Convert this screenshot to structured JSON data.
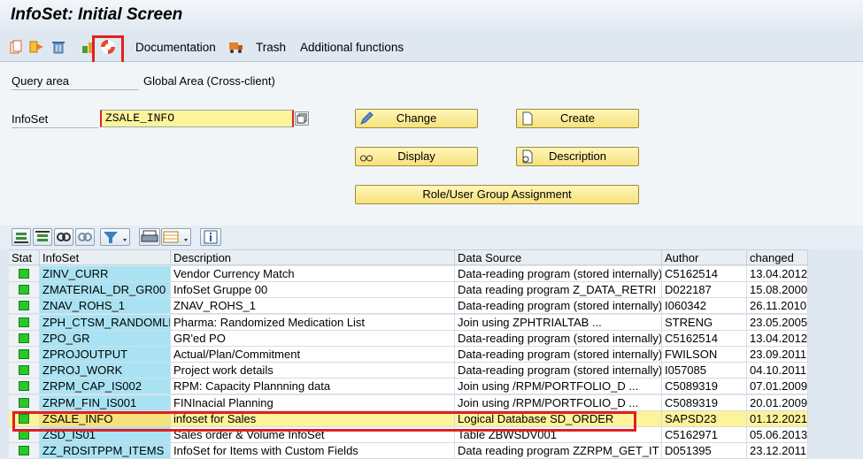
{
  "title": "InfoSet: Initial Screen",
  "toolbar": {
    "documentation": "Documentation",
    "trash": "Trash",
    "additional_functions": "Additional functions"
  },
  "form": {
    "query_area_label": "Query area",
    "query_area_value": "Global Area (Cross-client)",
    "infoset_label": "InfoSet",
    "infoset_value": "ZSALE_INFO"
  },
  "buttons": {
    "change": "Change",
    "create": "Create",
    "display": "Display",
    "description": "Description",
    "role_assignment": "Role/User Group Assignment"
  },
  "grid": {
    "headers": [
      "Stat",
      "InfoSet",
      "Description",
      "Data Source",
      "Author",
      "changed"
    ],
    "rows": [
      {
        "infoset": "ZINV_CURR",
        "description": "Vendor Currency Match",
        "source": "Data-reading program (stored internally)",
        "author": "C5162514",
        "changed": "13.04.2012"
      },
      {
        "infoset": "ZMATERIAL_DR_GR00",
        "description": "InfoSet Gruppe 00",
        "source": "Data reading program Z_DATA_RETRI",
        "author": "D022187",
        "changed": "15.08.2000"
      },
      {
        "infoset": "ZNAV_ROHS_1",
        "description": "ZNAV_ROHS_1",
        "source": "Data-reading program (stored internally)",
        "author": "I060342",
        "changed": "26.11.2010"
      },
      {
        "infoset": "ZPH_CTSM_RANDOMLI",
        "description": "Pharma: Randomized Medication List",
        "source": "Join using ZPHTRIALTAB ...",
        "author": "STRENG",
        "changed": "23.05.2005"
      },
      {
        "infoset": "ZPO_GR",
        "description": "GR'ed PO",
        "source": "Data-reading program (stored internally)",
        "author": "C5162514",
        "changed": "13.04.2012"
      },
      {
        "infoset": "ZPROJOUTPUT",
        "description": "Actual/Plan/Commitment",
        "source": "Data-reading program (stored internally)",
        "author": "FWILSON",
        "changed": "23.09.2011"
      },
      {
        "infoset": "ZPROJ_WORK",
        "description": "Project work details",
        "source": "Data-reading program (stored internally)",
        "author": "I057085",
        "changed": "04.10.2011"
      },
      {
        "infoset": "ZRPM_CAP_IS002",
        "description": "RPM: Capacity Plannning data",
        "source": "Join using /RPM/PORTFOLIO_D ...",
        "author": "C5089319",
        "changed": "07.01.2009"
      },
      {
        "infoset": "ZRPM_FIN_IS001",
        "description": "FINInacial Planning",
        "source": "Join using /RPM/PORTFOLIO_D ...",
        "author": "C5089319",
        "changed": "20.01.2009"
      },
      {
        "infoset": "ZSALE_INFO",
        "description": "infoset for Sales",
        "source": "Logical Database SD_ORDER",
        "author": "SAPSD23",
        "changed": "01.12.2021"
      },
      {
        "infoset": "ZSD_IS01",
        "description": "Sales order & Volume InfoSet",
        "source": "Table ZBWSDV001",
        "author": "C5162971",
        "changed": "05.06.2013"
      },
      {
        "infoset": "ZZ_RDSITPPM_ITEMS",
        "description": "InfoSet for Items with Custom Fields",
        "source": "Data reading program ZZRPM_GET_IT",
        "author": "D051395",
        "changed": "23.12.2011"
      }
    ]
  }
}
